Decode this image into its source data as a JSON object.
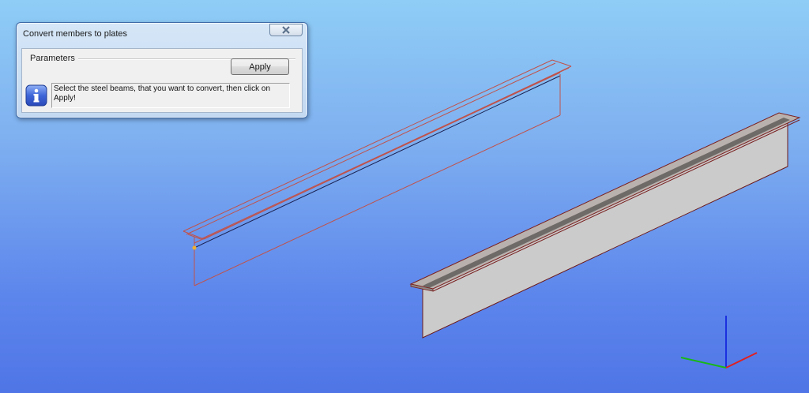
{
  "dialog": {
    "title": "Convert members to plates",
    "group_label": "Parameters",
    "apply_label": "Apply",
    "message": "Select the steel beams, that you want to convert, then click on Apply!",
    "close_icon": "close-icon",
    "info_icon": "info-icon"
  },
  "viewport": {
    "background_top": "#8fcdf6",
    "background_bottom": "#4f75e6",
    "beam_outline_color": "#c0524a",
    "beam_face_color": "#cbcbcb",
    "axis_colors": {
      "x": "#e02020",
      "y": "#18b818",
      "z": "#1a2fe0"
    }
  }
}
